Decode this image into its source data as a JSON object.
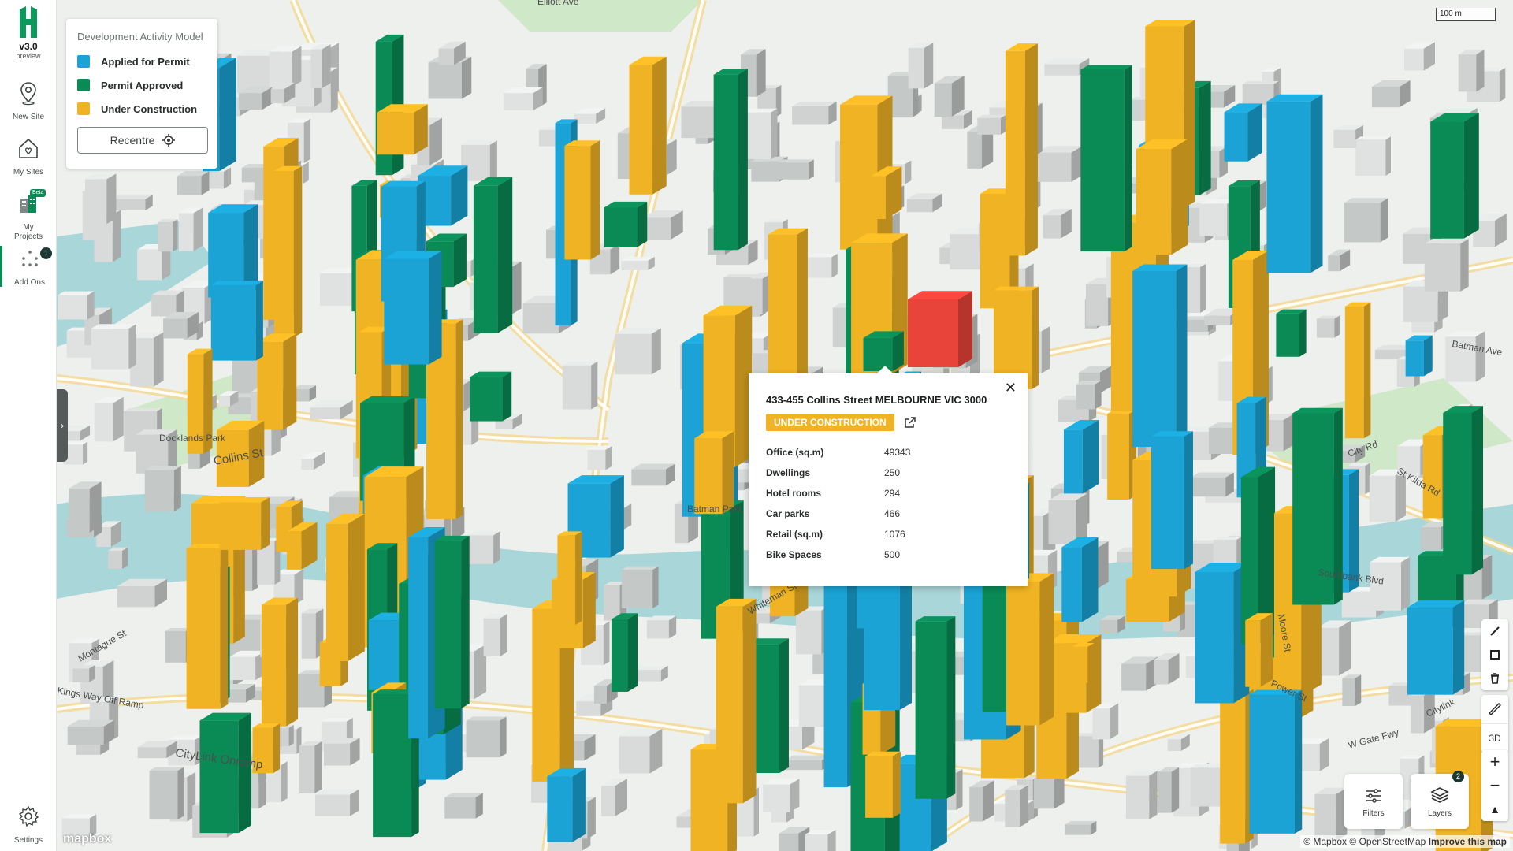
{
  "app": {
    "version": "v3.0",
    "version_sub": "preview"
  },
  "sidebar": {
    "items": [
      {
        "label": "New Site",
        "icon": "location-pin-icon"
      },
      {
        "label": "My Sites",
        "icon": "home-heart-icon"
      },
      {
        "label": "My Projects",
        "icon": "buildings-icon",
        "tag": "Beta"
      },
      {
        "label": "Add Ons",
        "icon": "dots-grid-icon",
        "badge": "1"
      }
    ],
    "settings_label": "Settings"
  },
  "legend": {
    "title": "Development Activity Model",
    "items": [
      {
        "label": "Applied for Permit",
        "color": "#1aa3d4"
      },
      {
        "label": "Permit Approved",
        "color": "#0a8a55"
      },
      {
        "label": "Under Construction",
        "color": "#f0b323"
      }
    ],
    "recentre_label": "Recentre"
  },
  "popup": {
    "address": "433-455 Collins Street MELBOURNE VIC 3000",
    "status": "UNDER CONSTRUCTION",
    "rows": [
      {
        "key": "Office (sq.m)",
        "value": "49343"
      },
      {
        "key": "Dwellings",
        "value": "250"
      },
      {
        "key": "Hotel rooms",
        "value": "294"
      },
      {
        "key": "Car parks",
        "value": "466"
      },
      {
        "key": "Retail (sq.m)",
        "value": "1076"
      },
      {
        "key": "Bike Spaces",
        "value": "500"
      }
    ]
  },
  "map": {
    "streets": [
      "Collins St",
      "CityLink Onramp",
      "Montague St",
      "Kings Way Off Ramp",
      "Whiteman St",
      "Power St",
      "W Gate Fwy",
      "Citylink",
      "St Kilda Rd",
      "City Rd",
      "Southbank Blvd",
      "Batman Ave",
      "Moore St",
      "Docklands Park",
      "Batman Park",
      "Elliott Ave"
    ],
    "scale_label": "100 m",
    "highlight_color": "#e8443a"
  },
  "controls": {
    "view_3d_label": "3D",
    "zoom_in": "+",
    "zoom_out": "−",
    "compass": "▲",
    "filters_label": "Filters",
    "layers_label": "Layers",
    "layers_badge": "2"
  },
  "attribution": {
    "mapbox": "© Mapbox",
    "osm": "© OpenStreetMap",
    "improve": "Improve this map",
    "logo": "mapbox"
  }
}
